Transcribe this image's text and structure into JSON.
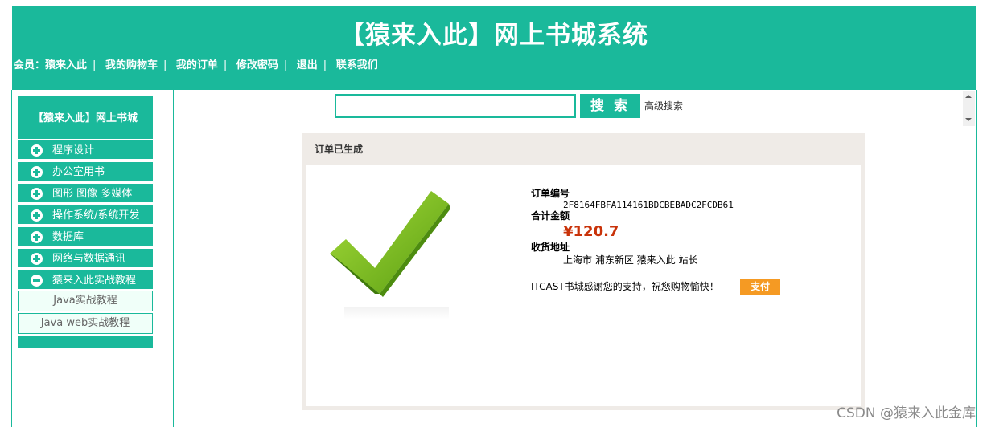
{
  "header": {
    "title": "【猿来入此】网上书城系统",
    "member_label": "会员：猿来入此",
    "nav": [
      "我的购物车",
      "我的订单",
      "修改密码",
      "退出",
      "联系我们"
    ]
  },
  "sidebar": {
    "title": "【猿来入此】网上书城",
    "categories": [
      {
        "label": "程序设计",
        "icon": "plus-circle-icon"
      },
      {
        "label": "办公室用书",
        "icon": "plus-circle-icon"
      },
      {
        "label": "图形 图像 多媒体",
        "icon": "plus-circle-icon"
      },
      {
        "label": "操作系统/系统开发",
        "icon": "plus-circle-icon"
      },
      {
        "label": "数据库",
        "icon": "plus-circle-icon"
      },
      {
        "label": "网络与数据通讯",
        "icon": "plus-circle-icon"
      },
      {
        "label": "猿来入此实战教程",
        "icon": "minus-circle-icon"
      }
    ],
    "subcategories": [
      "Java实战教程",
      "Java web实战教程"
    ]
  },
  "search": {
    "value": "",
    "button_label": "搜 索",
    "advanced_label": "高级搜索"
  },
  "order": {
    "panel_title": "订单已生成",
    "number_label": "订单编号",
    "number_value": "2F8164FBFA114161BDCBEBADC2FCDB61",
    "total_label": "合计金额",
    "total_value": "¥120.7",
    "address_label": "收货地址",
    "address_value": "上海市 浦东新区 猿来入此 站长",
    "thanks_text": "ITCAST书城感谢您的支持，祝您购物愉快！",
    "pay_label": "支付"
  },
  "watermark": "CSDN @猿来入此金库",
  "colors": {
    "accent": "#1ab99b",
    "price": "#c9330a",
    "pay": "#f59a23",
    "panel_bg": "#efebe7"
  }
}
